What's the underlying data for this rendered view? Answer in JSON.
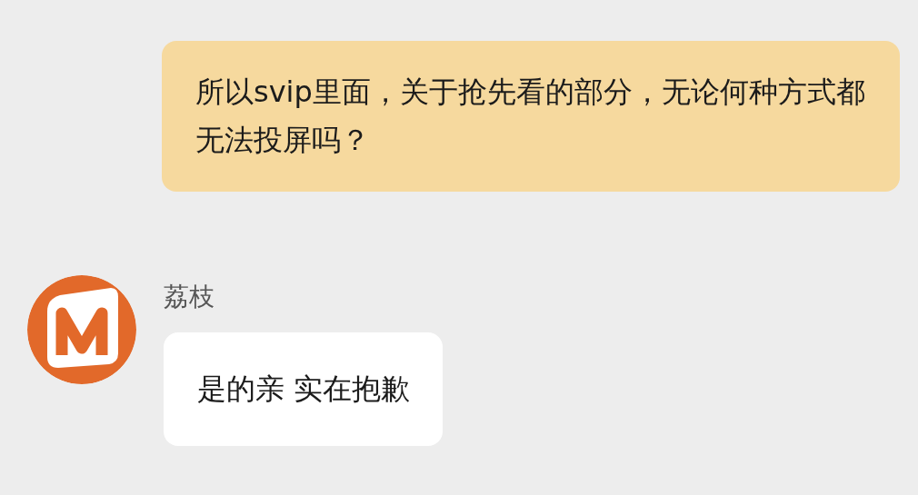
{
  "messages": [
    {
      "kind": "outgoing",
      "text": "所以svip里面，关于抢先看的部分，无论何种方式都无法投屏吗？"
    },
    {
      "kind": "incoming",
      "sender": "荔枝",
      "text": "是的亲 实在抱歉"
    }
  ]
}
